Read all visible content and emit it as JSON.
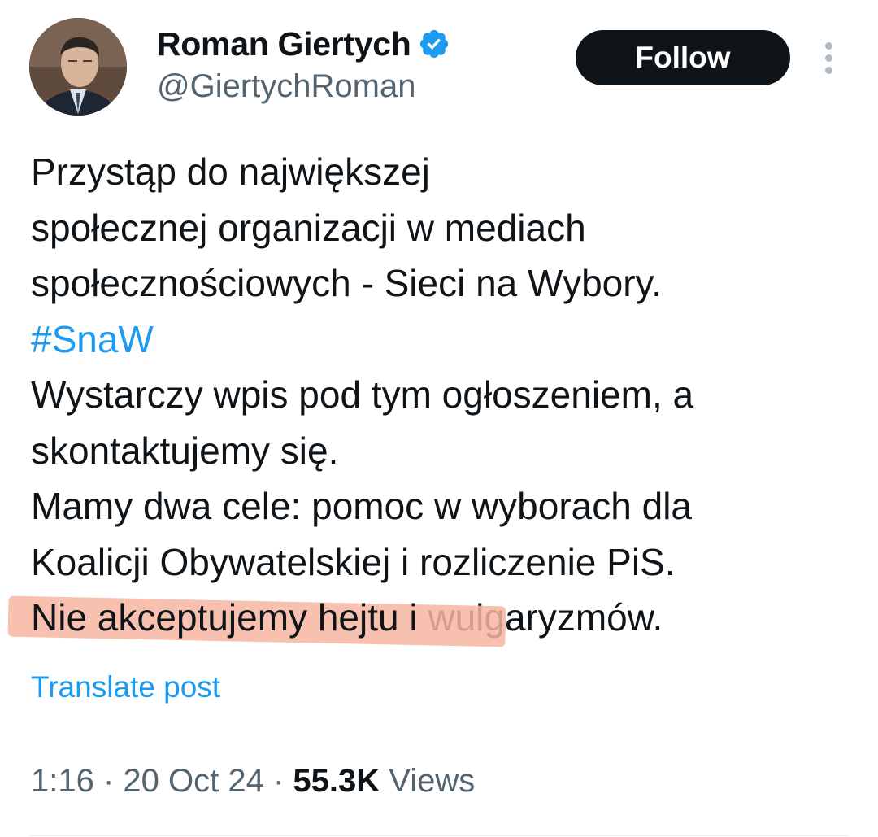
{
  "author": {
    "display_name": "Roman Giertych",
    "handle": "@GiertychRoman",
    "verified": true
  },
  "follow_button": {
    "label": "Follow"
  },
  "more_button": {
    "icon": "more-vertical-icon"
  },
  "tweet": {
    "lines": [
      "Przystąp do największej",
      "społecznej organizacji w mediach",
      "społecznościowych -  Sieci na Wybory.",
      "#SnaW",
      "Wystarczy wpis pod tym ogłoszeniem, a",
      "skontaktujemy się.",
      "Mamy dwa cele: pomoc w wyborach dla",
      "Koalicji Obywatelskiej i rozliczenie PiS."
    ],
    "last_line_highlighted": "Nie akceptujemy hejtu i",
    "last_line_rest": " wulgaryzmów."
  },
  "translate_label": "Translate post",
  "meta": {
    "time": "1:16",
    "sep1": " · ",
    "date": "20 Oct 24",
    "sep2": " · ",
    "views_count": "55.3K",
    "views_label": " Views"
  },
  "colors": {
    "accent": "#1d9bf0",
    "text": "#0f1419",
    "secondary": "#536471",
    "highlight": "#f7b5a1"
  }
}
